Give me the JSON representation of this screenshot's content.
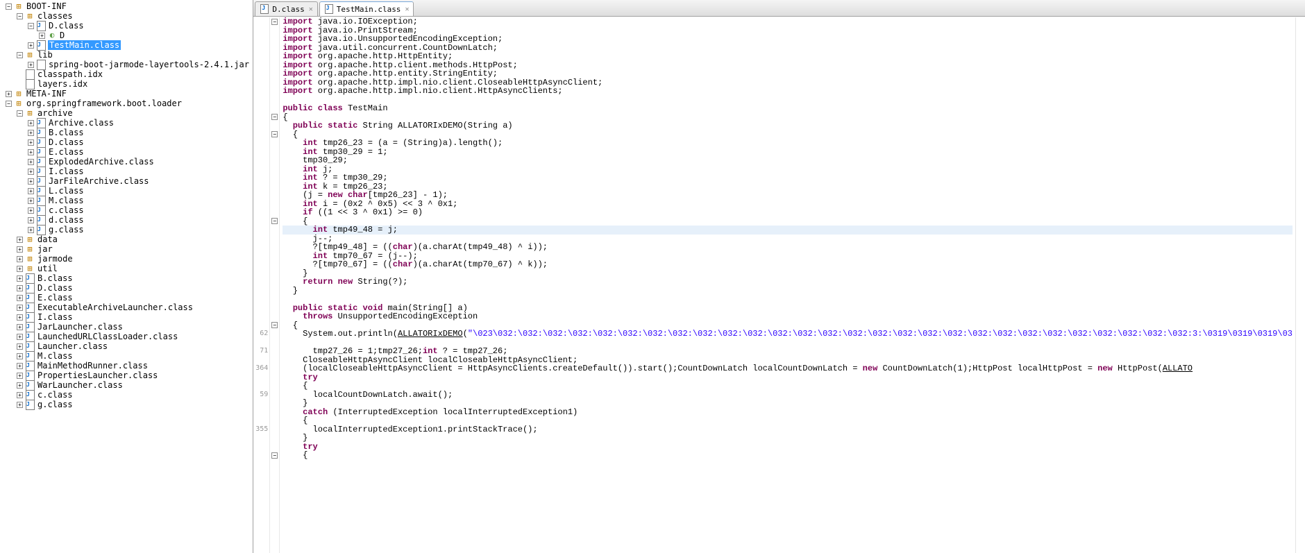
{
  "sidebar": {
    "root": [
      {
        "depth": 0,
        "toggle": "minus",
        "icon": "pkg",
        "label": "BOOT-INF",
        "sel": false
      },
      {
        "depth": 1,
        "toggle": "minus",
        "icon": "pkg",
        "label": "classes",
        "sel": false
      },
      {
        "depth": 2,
        "toggle": "minus",
        "icon": "class-file",
        "label": "D.class",
        "sel": false
      },
      {
        "depth": 3,
        "toggle": "plus",
        "icon": "ov",
        "label": "D",
        "sel": false
      },
      {
        "depth": 2,
        "toggle": "plus",
        "icon": "class-file",
        "label": "TestMain.class",
        "sel": true
      },
      {
        "depth": 1,
        "toggle": "minus",
        "icon": "pkg",
        "label": "lib",
        "sel": false
      },
      {
        "depth": 2,
        "toggle": "plus",
        "icon": "file-txt",
        "label": "spring-boot-jarmode-layertools-2.4.1.jar",
        "sel": false
      },
      {
        "depth": 1,
        "toggle": "blank",
        "icon": "file-txt",
        "label": "classpath.idx",
        "sel": false
      },
      {
        "depth": 1,
        "toggle": "blank",
        "icon": "file-txt",
        "label": "layers.idx",
        "sel": false
      },
      {
        "depth": 0,
        "toggle": "plus",
        "icon": "pkg",
        "label": "META-INF",
        "sel": false
      },
      {
        "depth": 0,
        "toggle": "minus",
        "icon": "pkg",
        "label": "org.springframework.boot.loader",
        "sel": false
      },
      {
        "depth": 1,
        "toggle": "minus",
        "icon": "pkg",
        "label": "archive",
        "sel": false
      },
      {
        "depth": 2,
        "toggle": "plus",
        "icon": "class-file",
        "label": "Archive.class",
        "sel": false
      },
      {
        "depth": 2,
        "toggle": "plus",
        "icon": "class-file",
        "label": "B.class",
        "sel": false
      },
      {
        "depth": 2,
        "toggle": "plus",
        "icon": "class-file",
        "label": "D.class",
        "sel": false
      },
      {
        "depth": 2,
        "toggle": "plus",
        "icon": "class-file",
        "label": "E.class",
        "sel": false
      },
      {
        "depth": 2,
        "toggle": "plus",
        "icon": "class-file",
        "label": "ExplodedArchive.class",
        "sel": false
      },
      {
        "depth": 2,
        "toggle": "plus",
        "icon": "class-file",
        "label": "I.class",
        "sel": false
      },
      {
        "depth": 2,
        "toggle": "plus",
        "icon": "class-file",
        "label": "JarFileArchive.class",
        "sel": false
      },
      {
        "depth": 2,
        "toggle": "plus",
        "icon": "class-file",
        "label": "L.class",
        "sel": false
      },
      {
        "depth": 2,
        "toggle": "plus",
        "icon": "class-file",
        "label": "M.class",
        "sel": false
      },
      {
        "depth": 2,
        "toggle": "plus",
        "icon": "class-file",
        "label": "c.class",
        "sel": false
      },
      {
        "depth": 2,
        "toggle": "plus",
        "icon": "class-file",
        "label": "d.class",
        "sel": false
      },
      {
        "depth": 2,
        "toggle": "plus",
        "icon": "class-file",
        "label": "g.class",
        "sel": false
      },
      {
        "depth": 1,
        "toggle": "plus",
        "icon": "pkg",
        "label": "data",
        "sel": false
      },
      {
        "depth": 1,
        "toggle": "plus",
        "icon": "pkg",
        "label": "jar",
        "sel": false
      },
      {
        "depth": 1,
        "toggle": "plus",
        "icon": "pkg",
        "label": "jarmode",
        "sel": false
      },
      {
        "depth": 1,
        "toggle": "plus",
        "icon": "pkg",
        "label": "util",
        "sel": false
      },
      {
        "depth": 1,
        "toggle": "plus",
        "icon": "class-file",
        "label": "B.class",
        "sel": false
      },
      {
        "depth": 1,
        "toggle": "plus",
        "icon": "class-file",
        "label": "D.class",
        "sel": false
      },
      {
        "depth": 1,
        "toggle": "plus",
        "icon": "class-file",
        "label": "E.class",
        "sel": false
      },
      {
        "depth": 1,
        "toggle": "plus",
        "icon": "class-file",
        "label": "ExecutableArchiveLauncher.class",
        "sel": false
      },
      {
        "depth": 1,
        "toggle": "plus",
        "icon": "class-file",
        "label": "I.class",
        "sel": false
      },
      {
        "depth": 1,
        "toggle": "plus",
        "icon": "class-file",
        "label": "JarLauncher.class",
        "sel": false
      },
      {
        "depth": 1,
        "toggle": "plus",
        "icon": "class-file",
        "label": "LaunchedURLClassLoader.class",
        "sel": false
      },
      {
        "depth": 1,
        "toggle": "plus",
        "icon": "class-file",
        "label": "Launcher.class",
        "sel": false
      },
      {
        "depth": 1,
        "toggle": "plus",
        "icon": "class-file",
        "label": "M.class",
        "sel": false
      },
      {
        "depth": 1,
        "toggle": "plus",
        "icon": "class-file",
        "label": "MainMethodRunner.class",
        "sel": false
      },
      {
        "depth": 1,
        "toggle": "plus",
        "icon": "class-file",
        "label": "PropertiesLauncher.class",
        "sel": false
      },
      {
        "depth": 1,
        "toggle": "plus",
        "icon": "class-file",
        "label": "WarLauncher.class",
        "sel": false
      },
      {
        "depth": 1,
        "toggle": "plus",
        "icon": "class-file",
        "label": "c.class",
        "sel": false
      },
      {
        "depth": 1,
        "toggle": "plus",
        "icon": "class-file",
        "label": "g.class",
        "sel": false
      }
    ]
  },
  "tabs": [
    {
      "label": "D.class",
      "active": false,
      "close": true
    },
    {
      "label": "TestMain.class",
      "active": true,
      "close": true
    }
  ],
  "code": {
    "lines": [
      {
        "fold": "minus",
        "hl": false,
        "html": "<span class='kw'>import</span> java.io.IOException;"
      },
      {
        "fold": "",
        "hl": false,
        "html": "<span class='kw'>import</span> java.io.PrintStream;"
      },
      {
        "fold": "",
        "hl": false,
        "html": "<span class='kw'>import</span> java.io.UnsupportedEncodingException;"
      },
      {
        "fold": "",
        "hl": false,
        "html": "<span class='kw'>import</span> java.util.concurrent.CountDownLatch;"
      },
      {
        "fold": "",
        "hl": false,
        "html": "<span class='kw'>import</span> org.apache.http.HttpEntity;"
      },
      {
        "fold": "",
        "hl": false,
        "html": "<span class='kw'>import</span> org.apache.http.client.methods.HttpPost;"
      },
      {
        "fold": "",
        "hl": false,
        "html": "<span class='kw'>import</span> org.apache.http.entity.StringEntity;"
      },
      {
        "fold": "",
        "hl": false,
        "html": "<span class='kw'>import</span> org.apache.http.impl.nio.client.CloseableHttpAsyncClient;"
      },
      {
        "fold": "",
        "hl": false,
        "html": "<span class='kw'>import</span> org.apache.http.impl.nio.client.HttpAsyncClients;"
      },
      {
        "fold": "",
        "hl": false,
        "html": ""
      },
      {
        "fold": "",
        "hl": false,
        "html": "<span class='kw'>public class</span> TestMain"
      },
      {
        "fold": "minus",
        "hl": false,
        "html": "{"
      },
      {
        "fold": "",
        "hl": false,
        "html": "  <span class='kw'>public static</span> String ALLATORIxDEMO(String a)"
      },
      {
        "fold": "minus",
        "hl": false,
        "html": "  {"
      },
      {
        "fold": "",
        "hl": false,
        "html": "    <span class='kw'>int</span> tmp26_23 = (a = (String)a).length();"
      },
      {
        "fold": "",
        "hl": false,
        "html": "    <span class='kw'>int</span> tmp30_29 = 1;"
      },
      {
        "fold": "",
        "hl": false,
        "html": "    tmp30_29;"
      },
      {
        "fold": "",
        "hl": false,
        "html": "    <span class='kw'>int</span> j;"
      },
      {
        "fold": "",
        "hl": false,
        "html": "    <span class='kw'>int</span> ? = tmp30_29;"
      },
      {
        "fold": "",
        "hl": false,
        "html": "    <span class='kw'>int</span> k = tmp26_23;"
      },
      {
        "fold": "",
        "hl": false,
        "html": "    (j = <span class='kw'>new</span> <span class='kw'>char</span>[tmp26_23] - 1);"
      },
      {
        "fold": "",
        "hl": false,
        "html": "    <span class='kw'>int</span> i = (0x2 ^ 0x5) &lt;&lt; 3 ^ 0x1;"
      },
      {
        "fold": "",
        "hl": false,
        "html": "    <span class='kw'>if</span> ((1 &lt;&lt; 3 ^ 0x1) &gt;= 0)"
      },
      {
        "fold": "minus",
        "hl": false,
        "html": "    {"
      },
      {
        "fold": "",
        "hl": true,
        "html": "      <span class='kw'>int</span> tmp49_48 = j;"
      },
      {
        "fold": "",
        "hl": false,
        "html": "      j--;"
      },
      {
        "fold": "",
        "hl": false,
        "html": "      ?[tmp49_48] = ((<span class='kw'>char</span>)(a.charAt(tmp49_48) ^ i));"
      },
      {
        "fold": "",
        "hl": false,
        "html": "      <span class='kw'>int</span> tmp70_67 = (j--);"
      },
      {
        "fold": "",
        "hl": false,
        "html": "      ?[tmp70_67] = ((<span class='kw'>char</span>)(a.charAt(tmp70_67) ^ k));"
      },
      {
        "fold": "",
        "hl": false,
        "html": "    }"
      },
      {
        "fold": "",
        "hl": false,
        "html": "    <span class='kw'>return</span> <span class='kw'>new</span> String(?);"
      },
      {
        "fold": "",
        "hl": false,
        "html": "  }"
      },
      {
        "fold": "",
        "hl": false,
        "html": "  "
      },
      {
        "fold": "",
        "hl": false,
        "html": "  <span class='kw'>public static void</span> main(String[] a)"
      },
      {
        "fold": "",
        "hl": false,
        "html": "    <span class='kw'>throws</span> UnsupportedEncodingException"
      },
      {
        "fold": "minus",
        "hl": false,
        "html": "  {"
      },
      {
        "fold": "",
        "gnum": "62",
        "hl": false,
        "html": "    System.out.println(<span class='underline'>ALLATORIxDEMO</span>(<span class='str'>\"\\023\\032:\\032:\\032:\\032:\\032:\\032:\\032:\\032:\\032:\\032:\\032:\\032:\\032:\\032:\\032:\\032:\\032:\\032:\\032:\\032:\\032:\\032:\\032:\\032:\\032:\\032:\\032:\\032:3:\\0319\\0319\\0319\\03</span>"
      },
      {
        "fold": "",
        "hl": false,
        "html": ""
      },
      {
        "fold": "",
        "gnum": "71",
        "hl": false,
        "html": "      tmp27_26 = 1;tmp27_26;<span class='kw'>int</span> ? = tmp27_26;"
      },
      {
        "fold": "",
        "hl": false,
        "html": "    CloseableHttpAsyncClient localCloseableHttpAsyncClient;"
      },
      {
        "fold": "",
        "gnum": "364",
        "hl": false,
        "html": "    (localCloseableHttpAsyncClient = HttpAsyncClients.createDefault()).start();CountDownLatch localCountDownLatch = <span class='kw'>new</span> CountDownLatch(1);HttpPost localHttpPost = <span class='kw'>new</span> HttpPost(<span class='underline'>ALLATO</span>"
      },
      {
        "fold": "",
        "hl": false,
        "html": "    <span class='kw'>try</span>"
      },
      {
        "fold": "",
        "hl": false,
        "html": "    {"
      },
      {
        "fold": "",
        "gnum": "59",
        "hl": false,
        "html": "      localCountDownLatch.await();"
      },
      {
        "fold": "",
        "hl": false,
        "html": "    }"
      },
      {
        "fold": "",
        "hl": false,
        "html": "    <span class='kw'>catch</span> (InterruptedException localInterruptedException1)"
      },
      {
        "fold": "",
        "hl": false,
        "html": "    {"
      },
      {
        "fold": "",
        "gnum": "355",
        "hl": false,
        "html": "      localInterruptedException1.printStackTrace();"
      },
      {
        "fold": "",
        "hl": false,
        "html": "    }"
      },
      {
        "fold": "",
        "hl": false,
        "html": "    <span class='kw'>try</span>"
      },
      {
        "fold": "minus",
        "hl": false,
        "html": "    {"
      }
    ]
  }
}
